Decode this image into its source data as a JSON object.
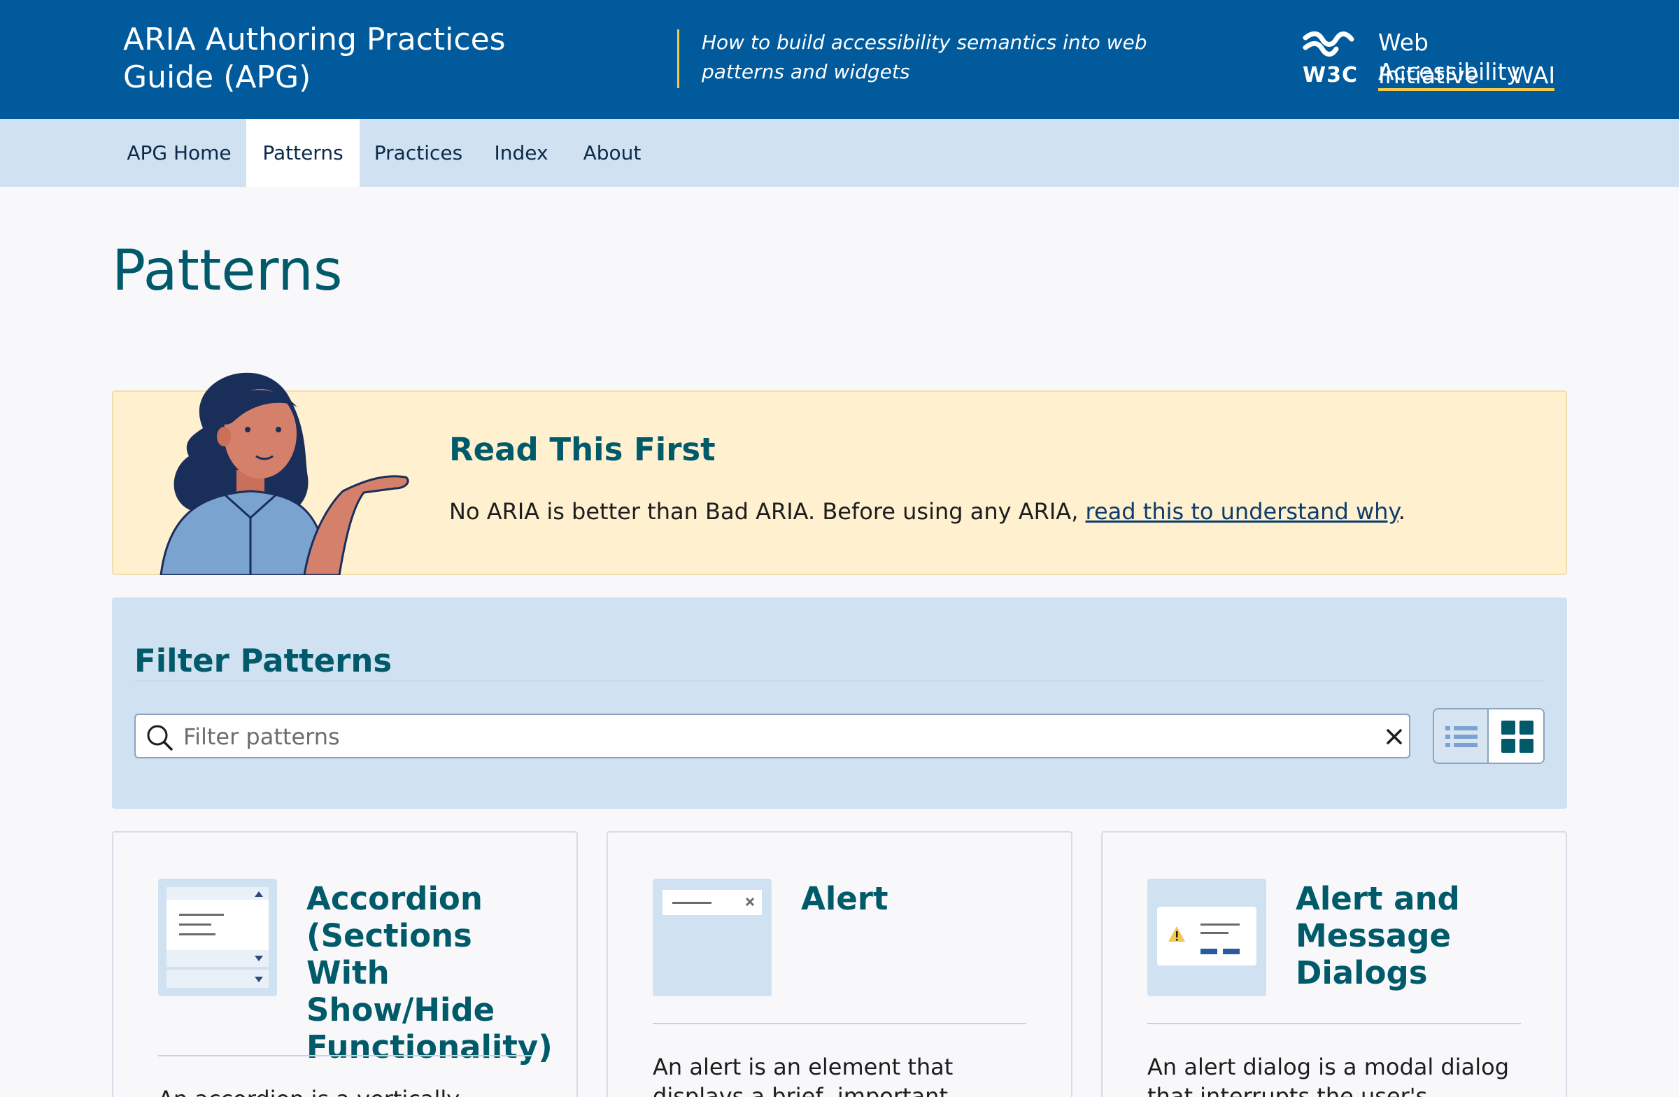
{
  "header": {
    "site_title": "ARIA Authoring Practices Guide (APG)",
    "tagline": "How to build accessibility semantics into web patterns and widgets",
    "w3c_label": "W3C",
    "wai_line1": "Web Accessibility",
    "wai_line2_left": "Initiative",
    "wai_line2_right": "WAI"
  },
  "nav": {
    "items": [
      {
        "label": "APG Home"
      },
      {
        "label": "Patterns",
        "active": true
      },
      {
        "label": "Practices"
      },
      {
        "label": "Index"
      },
      {
        "label": "About"
      }
    ]
  },
  "page": {
    "title": "Patterns"
  },
  "read_first": {
    "heading": "Read This First",
    "text_before": "No ARIA is better than Bad ARIA. Before using any ARIA, ",
    "link_text": "read this to understand why",
    "text_after": "."
  },
  "filter": {
    "heading": "Filter Patterns",
    "placeholder": "Filter patterns",
    "value": "",
    "view_mode": "grid"
  },
  "cards": [
    {
      "title": "Accordion (Sections With Show/Hide Functionality)",
      "description": "An accordion is a vertically stacked",
      "icon": "accordion-illustration-icon"
    },
    {
      "title": "Alert",
      "description": "An alert is an element that displays a brief, important message in a",
      "icon": "alert-illustration-icon"
    },
    {
      "title": "Alert and Message Dialogs",
      "description": "An alert dialog is a modal dialog that interrupts the user's workflow",
      "icon": "alert-dialog-illustration-icon"
    }
  ],
  "colors": {
    "header_bg": "#005a9c",
    "nav_bg": "#d0e1f1",
    "accent_yellow": "#f2c94c",
    "heading_teal": "#005a6a",
    "notice_bg": "#fff0cf"
  }
}
